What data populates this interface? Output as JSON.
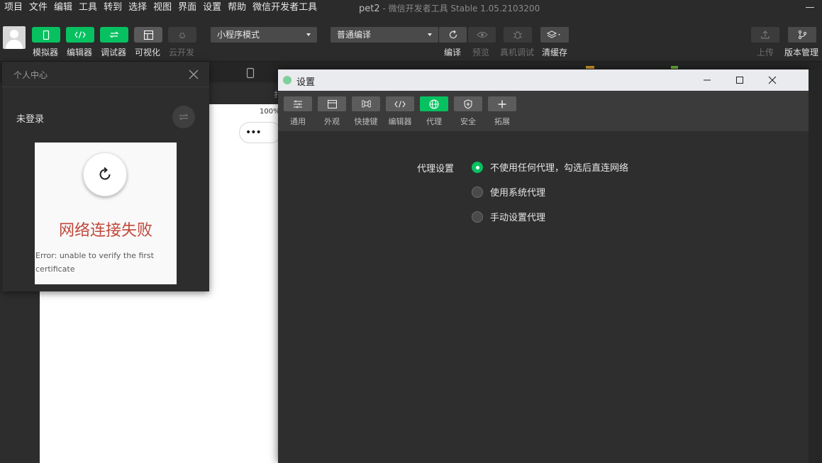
{
  "menu": [
    "项目",
    "文件",
    "编辑",
    "工具",
    "转到",
    "选择",
    "视图",
    "界面",
    "设置",
    "帮助",
    "微信开发者工具"
  ],
  "window_title": {
    "project": "pet2",
    "rest": " - 微信开发者工具 Stable 1.05.2103200"
  },
  "toolbar": {
    "simulator": "模拟器",
    "editor": "编辑器",
    "debugger": "调试器",
    "visual": "可视化",
    "cloud": "云开发",
    "mode_select": "小程序模式",
    "compile_select": "普通编译",
    "compile": "编译",
    "preview": "预览",
    "real_debug": "真机调试",
    "clear_cache": "清缓存",
    "upload": "上传",
    "version": "版本管理"
  },
  "simulator": {
    "zoom": "100%",
    "capsule": "•••",
    "partial_label": "扌"
  },
  "personal_center": {
    "title": "个人中心",
    "login_status": "未登录",
    "error_title": "网络连接失败",
    "error_message": "Error: unable to verify the first certificate"
  },
  "settings": {
    "title": "设置",
    "tabs": [
      {
        "label": "通用",
        "icon": "list-icon"
      },
      {
        "label": "外观",
        "icon": "window-icon"
      },
      {
        "label": "快捷键",
        "icon": "command-icon"
      },
      {
        "label": "编辑器",
        "icon": "code-icon"
      },
      {
        "label": "代理",
        "icon": "globe-icon",
        "active": true
      },
      {
        "label": "安全",
        "icon": "shield-icon"
      },
      {
        "label": "拓展",
        "icon": "plus-icon"
      }
    ],
    "proxy_label": "代理设置",
    "proxy_options": [
      {
        "label": "不使用任何代理，勾选后直连网络",
        "selected": true
      },
      {
        "label": "使用系统代理",
        "selected": false
      },
      {
        "label": "手动设置代理",
        "selected": false
      }
    ]
  },
  "colors": {
    "accent": "#07c160",
    "error": "#c0483b"
  }
}
